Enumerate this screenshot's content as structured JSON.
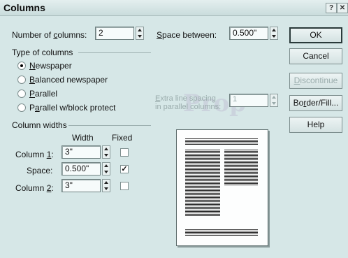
{
  "window": {
    "title": "Columns",
    "help_icon": "?",
    "close_icon": "✕"
  },
  "num_columns": {
    "label_pre": "Number of ",
    "label_u": "c",
    "label_post": "olumns:",
    "value": "2"
  },
  "space_between": {
    "label_u": "S",
    "label_post": "pace between:",
    "value": "0.500\""
  },
  "type_group": {
    "title": "Type of columns",
    "options": [
      {
        "u": "N",
        "rest": "ewspaper",
        "selected": true
      },
      {
        "u": "B",
        "rest": "alanced newspaper",
        "selected": false
      },
      {
        "u": "P",
        "rest": "arallel",
        "selected": false
      },
      {
        "pre": "P",
        "u": "a",
        "rest": "rallel w/block protect",
        "selected": false
      }
    ]
  },
  "extra_spacing": {
    "line1_u": "E",
    "line1": "xtra line spacing",
    "line2": "in parallel columns:",
    "value": "1"
  },
  "widths_group": {
    "title": "Column widths",
    "col_width": "Width",
    "col_fixed": "Fixed",
    "rows": [
      {
        "label_pre": "Column ",
        "label_u": "1",
        "label_post": ":",
        "value": "3\"",
        "fixed": false
      },
      {
        "label_pre": "Space:",
        "label_u": "",
        "label_post": "",
        "value": "0.500\"",
        "fixed": true
      },
      {
        "label_pre": "Column ",
        "label_u": "2",
        "label_post": ":",
        "value": "3\"",
        "fixed": false
      }
    ]
  },
  "buttons": {
    "ok": "OK",
    "cancel": "Cancel",
    "discontinue_u": "D",
    "discontinue": "iscontinue",
    "border_pre": "Bo",
    "border_u": "r",
    "border_post": "der/Fill...",
    "help": "Help"
  },
  "colors": {
    "background": "#d6e7e7",
    "titlebar": "#c9dcdc",
    "disabled_text": "#9aacac"
  }
}
